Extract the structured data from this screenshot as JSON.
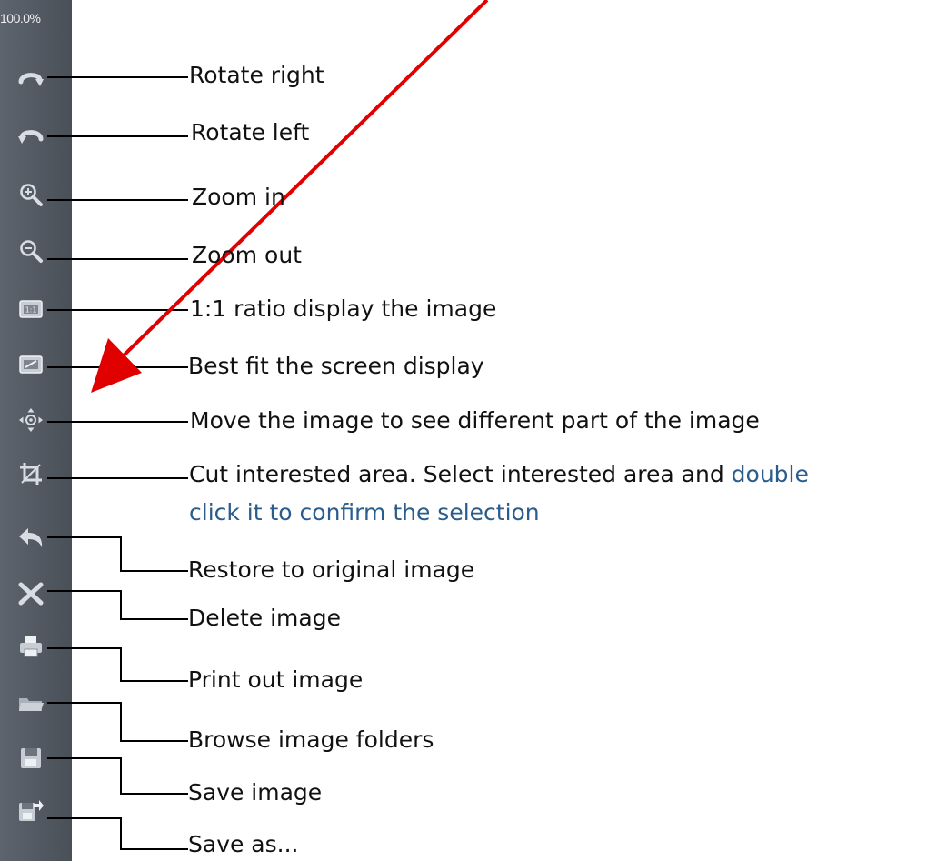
{
  "toolbar": {
    "zoom_level": "100.0%",
    "buttons": [
      {
        "icon": "rotate-right-icon",
        "label": "Rotate right"
      },
      {
        "icon": "rotate-left-icon",
        "label": "Rotate left"
      },
      {
        "icon": "zoom-in-icon",
        "label": "Zoom in"
      },
      {
        "icon": "zoom-out-icon",
        "label": "Zoom out"
      },
      {
        "icon": "ratio-1-1-icon",
        "label": "1:1 ratio display the image"
      },
      {
        "icon": "best-fit-icon",
        "label": "Best fit the screen display"
      },
      {
        "icon": "move-icon",
        "label": "Move the image to see different part of the image"
      },
      {
        "icon": "crop-icon",
        "label": "Cut interested area. Select interested area and",
        "label_highlight": "double",
        "label_cont": "click it to confirm the selection"
      },
      {
        "icon": "undo-icon",
        "label": "Restore to original image"
      },
      {
        "icon": "delete-icon",
        "label": "Delete image"
      },
      {
        "icon": "print-icon",
        "label": "Print out image"
      },
      {
        "icon": "folder-icon",
        "label": "Browse image folders"
      },
      {
        "icon": "save-icon",
        "label": "Save image"
      },
      {
        "icon": "save-as-icon",
        "label": "Save as..."
      }
    ]
  },
  "colors": {
    "toolbar_bg": "#555c65",
    "icon": "#d8dde3",
    "annotation_arrow": "#e00000",
    "highlight_text": "#2a5c8c"
  }
}
